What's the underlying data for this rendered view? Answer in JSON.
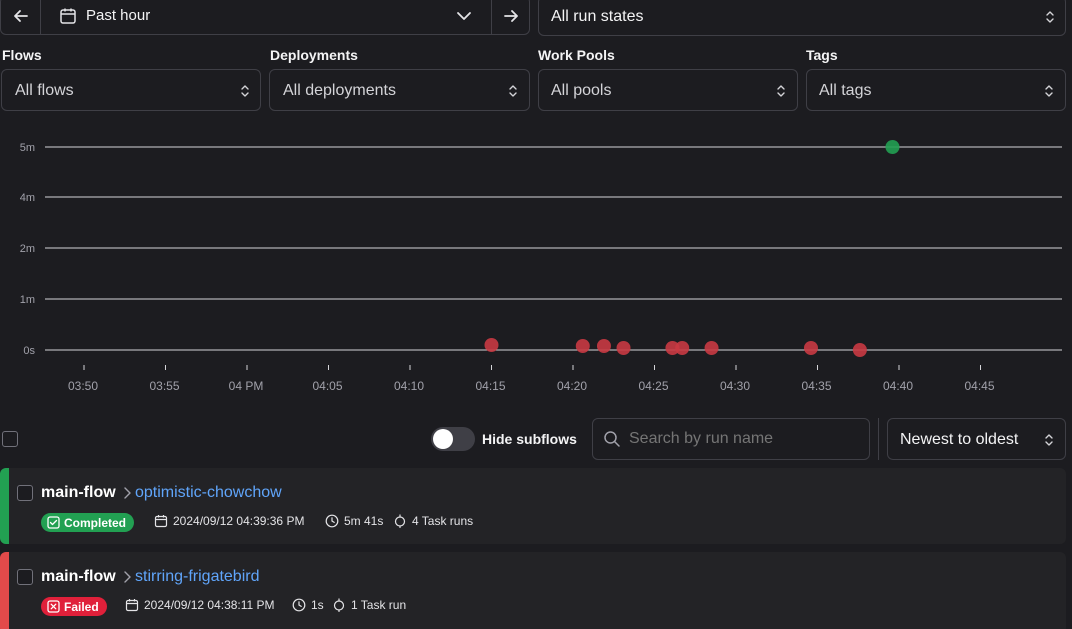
{
  "time_range": {
    "label": "Past hour"
  },
  "run_states": {
    "value": "All run states"
  },
  "filters": [
    {
      "label": "Flows",
      "value": "All flows"
    },
    {
      "label": "Deployments",
      "value": "All deployments"
    },
    {
      "label": "Work Pools",
      "value": "All pools"
    },
    {
      "label": "Tags",
      "value": "All tags"
    }
  ],
  "chart_data": {
    "type": "scatter",
    "x_ticks": [
      "03:50",
      "03:55",
      "04 PM",
      "04:05",
      "04:10",
      "04:15",
      "04:20",
      "04:25",
      "04:30",
      "04:35",
      "04:40",
      "04:45"
    ],
    "y_ticks": [
      "0s",
      "1m",
      "2m",
      "4m",
      "5m"
    ],
    "x_unit": "minutes from 03:50",
    "series": [
      {
        "state": "completed",
        "color": "#22a052",
        "points": [
          {
            "x": 49.6,
            "y": "5m 41s"
          }
        ]
      },
      {
        "state": "failed",
        "color": "#c93a43",
        "points": [
          {
            "x": 25.0,
            "y": "1s"
          },
          {
            "x": 30.6,
            "y": "1s"
          },
          {
            "x": 31.9,
            "y": "1s"
          },
          {
            "x": 33.1,
            "y": "1s"
          },
          {
            "x": 36.1,
            "y": "1s"
          },
          {
            "x": 36.7,
            "y": "1s"
          },
          {
            "x": 38.5,
            "y": "1s"
          },
          {
            "x": 44.6,
            "y": "1s"
          },
          {
            "x": 47.6,
            "y": "1s"
          }
        ]
      }
    ]
  },
  "toolbar": {
    "hide_subflows_label": "Hide subflows",
    "search_placeholder": "Search by run name",
    "sort_value": "Newest to oldest"
  },
  "runs": [
    {
      "flow": "main-flow",
      "name": "optimistic-chowchow",
      "state": "Completed",
      "state_color": "#22a052",
      "start": "2024/09/12 04:39:36 PM",
      "duration": "5m 41s",
      "tasks": "4 Task runs"
    },
    {
      "flow": "main-flow",
      "name": "stirring-frigatebird",
      "state": "Failed",
      "state_color": "#e0203a",
      "start": "2024/09/12 04:38:11 PM",
      "duration": "1s",
      "tasks": "1 Task run"
    }
  ]
}
